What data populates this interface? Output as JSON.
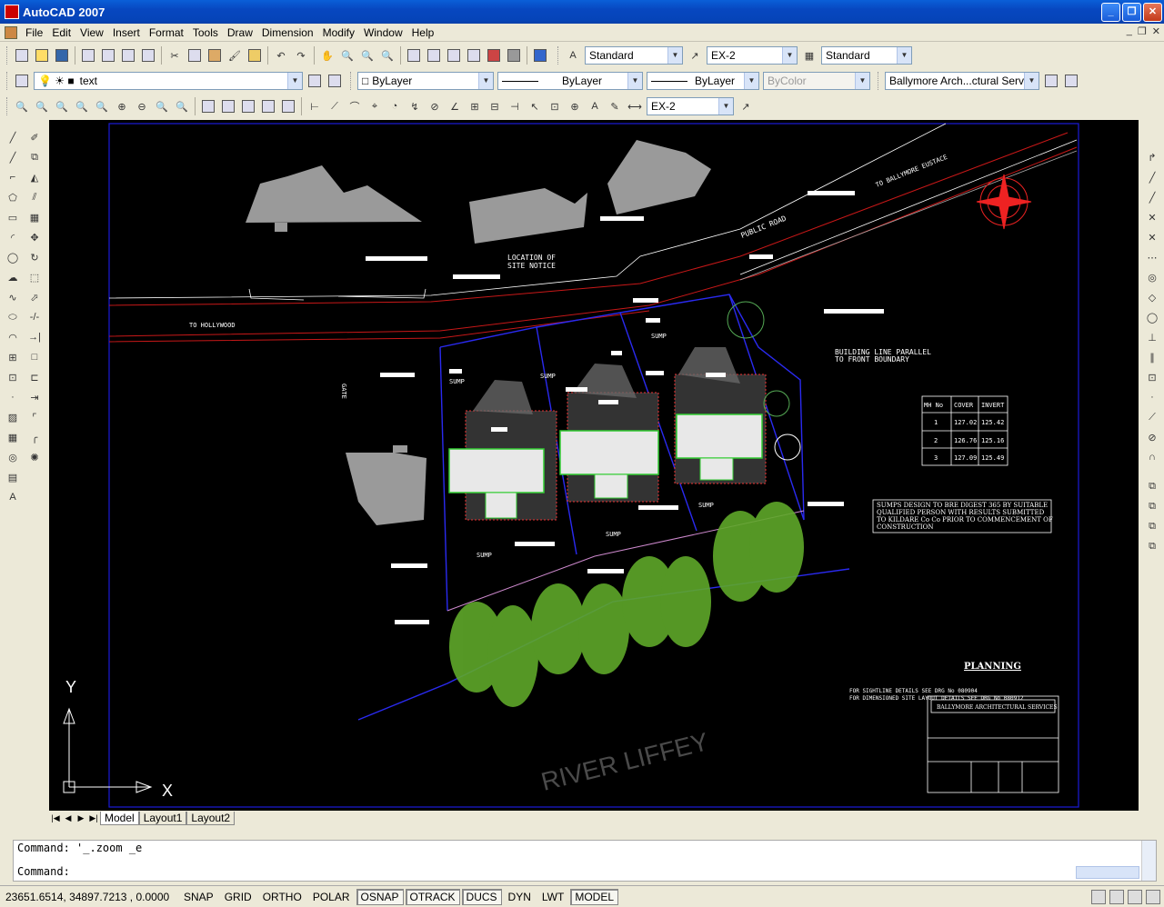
{
  "window": {
    "title": "AutoCAD 2007"
  },
  "menu": [
    "File",
    "Edit",
    "View",
    "Insert",
    "Format",
    "Tools",
    "Draw",
    "Dimension",
    "Modify",
    "Window",
    "Help"
  ],
  "toolbar": {
    "text_style": "Standard",
    "dim_style": "EX-2",
    "table_style": "Standard",
    "layer": "text",
    "color": "ByLayer",
    "linetype": "ByLayer",
    "lineweight": "ByLayer",
    "plotstyle": "ByColor",
    "plot_config": "Ballymore Arch...ctural Service",
    "dim_style_2": "EX-2"
  },
  "drawing": {
    "labels": {
      "hollywood": "TO HOLLYWOOD",
      "ballymore": "TO BALLYMORE EUSTACE",
      "public_road": "PUBLIC ROAD",
      "location": "LOCATION OF",
      "site_notice": "SITE NOTICE",
      "building_line_1": "BUILDING LINE PARALLEL",
      "building_line_2": "TO FRONT BOUNDARY",
      "sump": "SUMP",
      "gate": "GATE",
      "note1": "SUMPS DESIGN TO BRE DIGEST 365 BY SUITABLE",
      "note2": "QUALIFIED PERSON WITH RESULTS SUBMITTED",
      "note3": "TO KILDARE Co Co PRIOR TO COMMENCEMENT OF",
      "note4": "CONSTRUCTION",
      "sightline": "FOR SIGHTLINE DETAILS SEE DRG No 080904",
      "dim_layout": "FOR DIMENSIONED SITE LAYOUT DETAILS SEE DRG No 080912",
      "planning": "PLANNING",
      "river": "RIVER LIFFEY",
      "titleblock": "BALLYMORE ARCHITECTURAL SERVICES",
      "ucs_y": "Y",
      "ucs_x": "X"
    },
    "mh_table": {
      "headers": [
        "MH No",
        "COVER",
        "INVERT"
      ],
      "rows": [
        [
          "1",
          "127.02",
          "125.42"
        ],
        [
          "2",
          "126.76",
          "125.16"
        ],
        [
          "3",
          "127.09",
          "125.49"
        ]
      ]
    }
  },
  "tabs": [
    "Model",
    "Layout1",
    "Layout2"
  ],
  "command": {
    "line1": "Command: '_.zoom _e",
    "line2": "Command:"
  },
  "status": {
    "coords": "23651.6514, 34897.7213 , 0.0000",
    "buttons": [
      {
        "label": "SNAP",
        "on": false
      },
      {
        "label": "GRID",
        "on": false
      },
      {
        "label": "ORTHO",
        "on": false
      },
      {
        "label": "POLAR",
        "on": false
      },
      {
        "label": "OSNAP",
        "on": true
      },
      {
        "label": "OTRACK",
        "on": true
      },
      {
        "label": "DUCS",
        "on": true
      },
      {
        "label": "DYN",
        "on": false
      },
      {
        "label": "LWT",
        "on": false
      },
      {
        "label": "MODEL",
        "on": true
      }
    ]
  }
}
